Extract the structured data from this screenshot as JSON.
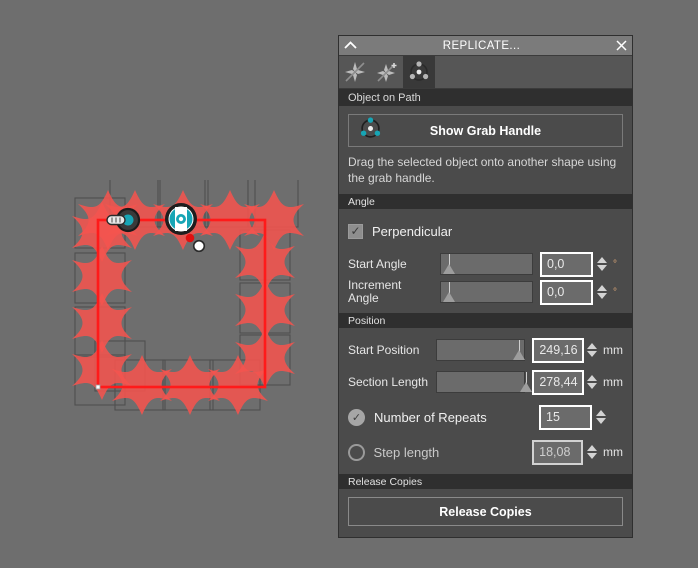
{
  "window": {
    "title": "REPLICATE...",
    "collapse_icon": "chevron-up-icon",
    "close_icon": "close-icon"
  },
  "tabs": [
    {
      "id": "scatter",
      "icon": "scatter-copies-icon",
      "active": false
    },
    {
      "id": "scatter-add",
      "icon": "scatter-copies-add-icon",
      "active": false
    },
    {
      "id": "object-on-path",
      "icon": "object-on-path-icon",
      "active": true
    }
  ],
  "active_tab_label": "Object on Path",
  "grab": {
    "button_label": "Show Grab Handle",
    "icon": "grab-handle-icon",
    "hint": "Drag the selected object onto another shape using the grab handle."
  },
  "sections": {
    "angle": {
      "header": "Angle",
      "perpendicular": {
        "label": "Perpendicular",
        "checked": true,
        "check_glyph": "✓"
      },
      "start_angle": {
        "label": "Start Angle",
        "value": "0,0",
        "unit": "°",
        "slider_pct": 3
      },
      "increment_angle": {
        "label": "Increment\nAngle",
        "label_line1": "Increment",
        "label_line2": "Angle",
        "value": "0,0",
        "unit": "°",
        "slider_pct": 3
      }
    },
    "position": {
      "header": "Position",
      "start_position": {
        "label": "Start Position",
        "value": "249,16",
        "unit": "mm",
        "slider_pct": 86
      },
      "section_length": {
        "label": "Section Length",
        "value": "278,44",
        "unit": "mm",
        "slider_pct": 94
      },
      "number_of_repeats": {
        "label": "Number of Repeats",
        "value": "15",
        "selected": true,
        "check_glyph": "✓"
      },
      "step_length": {
        "label": "Step length",
        "value": "18,08",
        "unit": "mm",
        "selected": false
      }
    },
    "release": {
      "header": "Release Copies",
      "button_label": "Release Copies"
    }
  },
  "canvas": {
    "name": "object-on-path-preview",
    "path_color": "#ff1a1a",
    "shape_fill": "#f4544e",
    "shape_count": 15,
    "grab_handle_color": "#17a5b5",
    "node_marker_color": "#e01010"
  }
}
